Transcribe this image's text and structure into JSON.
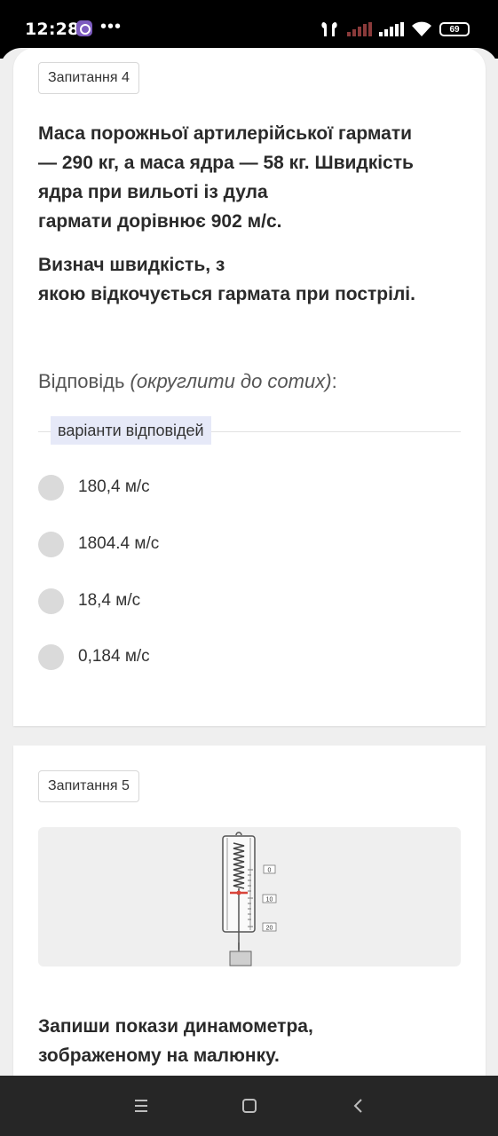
{
  "status_bar": {
    "time": "12:28",
    "dots": "•••",
    "battery": "69"
  },
  "question4": {
    "tag": "Запитання 4",
    "text_lines": [
      "Маса порожньої артилерійської гармати",
      "— 290 кг, а маса ядра — 58 кг. Швидкість",
      "ядра при вильоті із дула",
      "гармати дорівнює 902 м/с."
    ],
    "task_lines": [
      "Визнач швидкість, з",
      "якою відкочується гармата при пострілі."
    ],
    "answer_prefix": "Відповідь ",
    "answer_hint": "(округлити до сотих)",
    "answer_suffix": ":",
    "variants_label": "варіанти відповідей",
    "options": [
      "180,4 м/с",
      "1804.4 м/с",
      "18,4 м/с",
      "0,184 м/с"
    ]
  },
  "question5": {
    "tag": "Запитання 5",
    "scale_labels": [
      "0",
      "10",
      "20"
    ],
    "text_lines": [
      "Запиши покази динамометра,",
      "зображеному на малюнку."
    ]
  },
  "colors": {
    "radio": "#dadada",
    "variants_bg": "#e6e9f8",
    "indicator": "#d8453a"
  }
}
